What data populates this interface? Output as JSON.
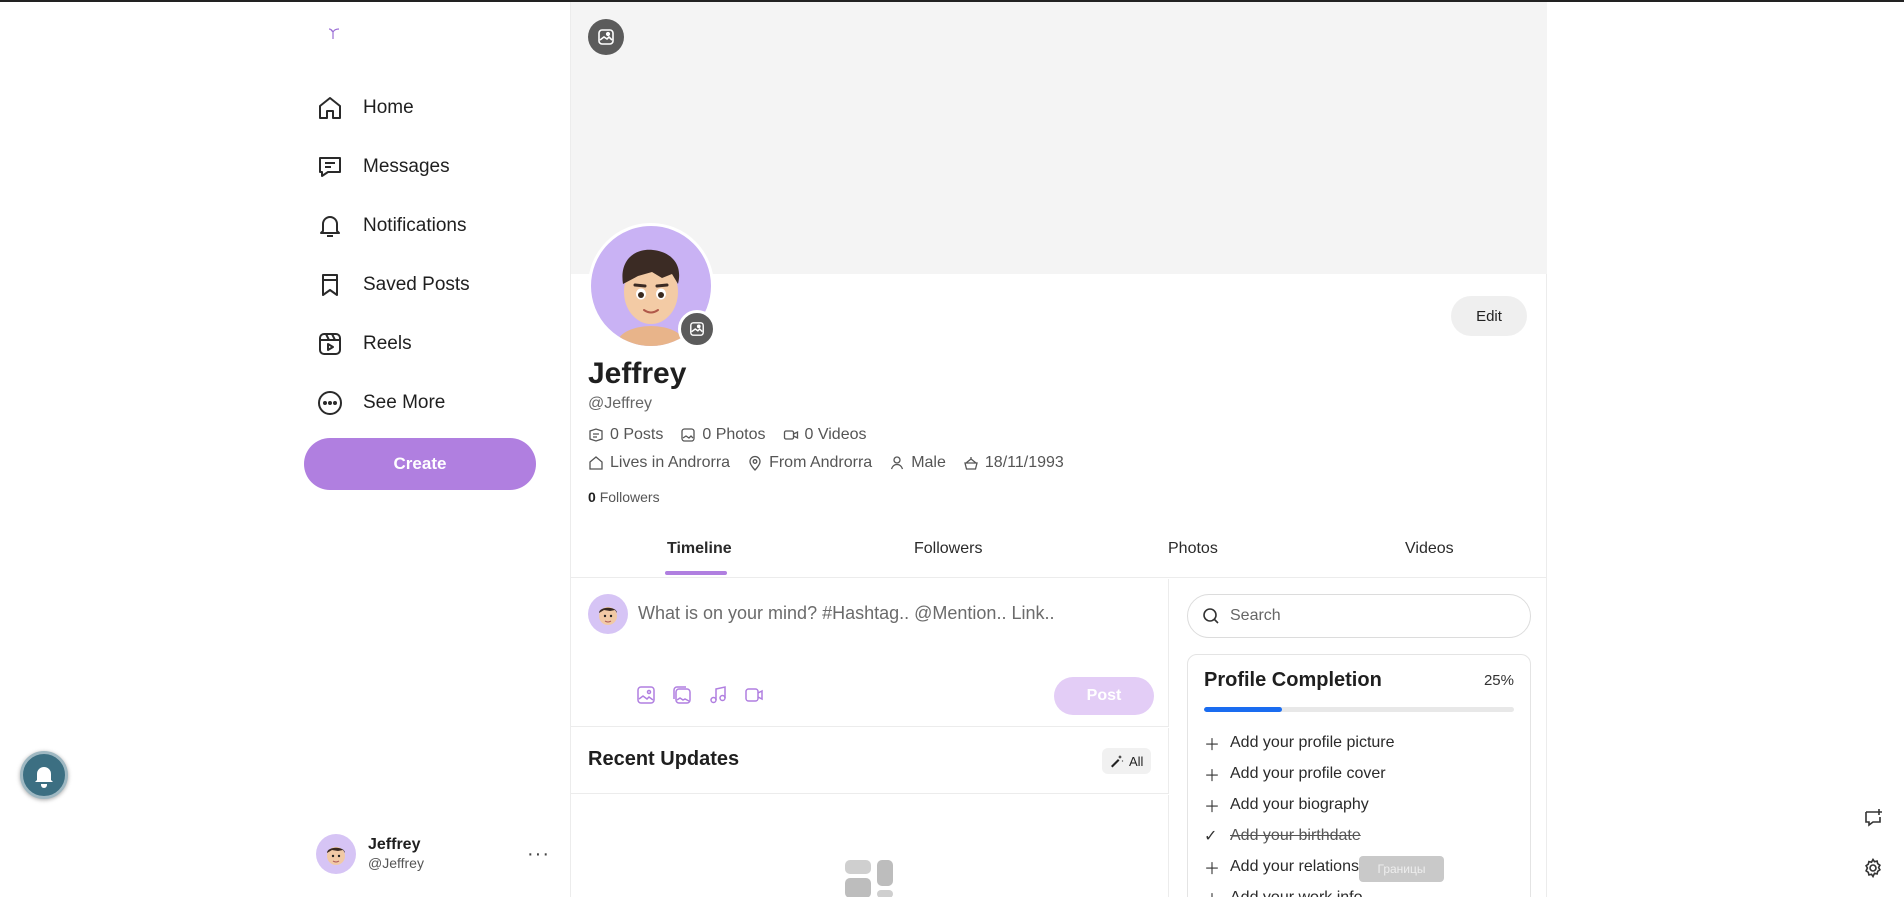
{
  "sidebar": {
    "logo_icon": "feather-logo-icon",
    "items": [
      {
        "label": "Home",
        "icon": "home-icon"
      },
      {
        "label": "Messages",
        "icon": "message-icon"
      },
      {
        "label": "Notifications",
        "icon": "bell-icon"
      },
      {
        "label": "Saved Posts",
        "icon": "bookmark-icon"
      },
      {
        "label": "Reels",
        "icon": "reels-icon"
      },
      {
        "label": "See More",
        "icon": "more-circle-icon"
      }
    ],
    "create_label": "Create",
    "user": {
      "name": "Jeffrey",
      "handle": "@Jeffrey",
      "menu": "···"
    }
  },
  "profile": {
    "name": "Jeffrey",
    "handle": "@Jeffrey",
    "edit_label": "Edit",
    "stats": {
      "posts": "0 Posts",
      "photos": "0 Photos",
      "videos": "0 Videos"
    },
    "info": {
      "lives": "Lives in Androrra",
      "from": "From Androrra",
      "gender": "Male",
      "birthday": "18/11/1993"
    },
    "followers_count": "0",
    "followers_label": "Followers"
  },
  "tabs": [
    "Timeline",
    "Followers",
    "Photos",
    "Videos"
  ],
  "composer": {
    "placeholder": "What is on your mind? #Hashtag.. @Mention.. Link..",
    "post_label": "Post"
  },
  "recent": {
    "title": "Recent Updates",
    "filter_label": "All"
  },
  "right": {
    "search_placeholder": "Search",
    "completion": {
      "title": "Profile Completion",
      "percent_label": "25%",
      "percent": 25,
      "items": [
        {
          "label": "Add your profile picture",
          "done": false
        },
        {
          "label": "Add your profile cover",
          "done": false
        },
        {
          "label": "Add your biography",
          "done": false
        },
        {
          "label": "Add your birthdate",
          "done": true
        },
        {
          "label": "Add your relationship",
          "done": false
        },
        {
          "label": "Add your work info",
          "done": false
        }
      ]
    },
    "tooltip": "Границы"
  },
  "colors": {
    "accent": "#b07fe0",
    "progress": "#1a6cf0",
    "cover": "#f4f4f4"
  }
}
